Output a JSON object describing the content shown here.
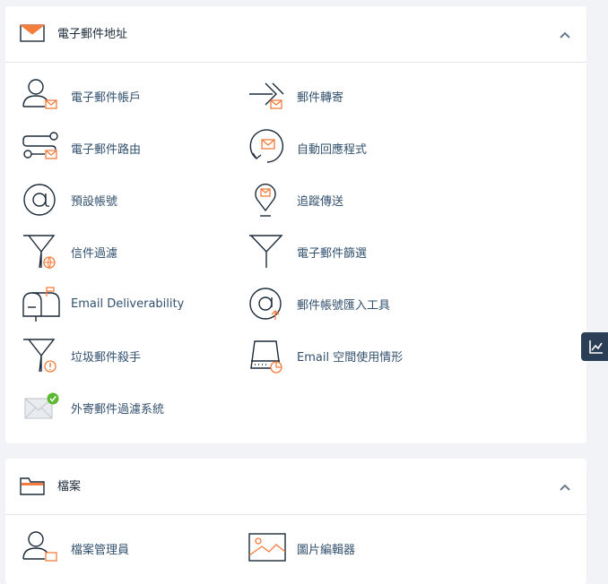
{
  "email_section": {
    "title": "電子郵件地址",
    "items": [
      {
        "label": "電子郵件帳戶"
      },
      {
        "label": "郵件轉寄"
      },
      {
        "label": "電子郵件路由"
      },
      {
        "label": "自動回應程式"
      },
      {
        "label": "預設帳號"
      },
      {
        "label": "追蹤傳送"
      },
      {
        "label": "信件過濾"
      },
      {
        "label": "電子郵件篩選"
      },
      {
        "label": "Email Deliverability"
      },
      {
        "label": "郵件帳號匯入工具"
      },
      {
        "label": "垃圾郵件殺手"
      },
      {
        "label": "Email 空間使用情形"
      },
      {
        "label": "外寄郵件過濾系統"
      }
    ]
  },
  "files_section": {
    "title": "檔案",
    "items": [
      {
        "label": "檔案管理員"
      },
      {
        "label": "圖片編輯器"
      }
    ]
  },
  "colors": {
    "accent": "#f47c3c",
    "line": "#1b2a3a",
    "label": "#33516f",
    "side_tab": "#2a3f55"
  }
}
